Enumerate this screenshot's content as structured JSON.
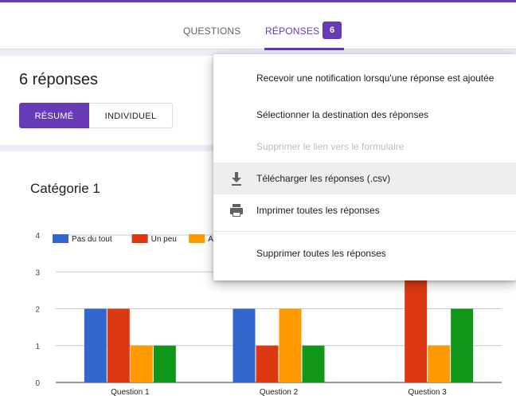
{
  "tabs": {
    "questions_label": "QUESTIONS",
    "responses_label": "RÉPONSES",
    "responses_count": "6"
  },
  "summary": {
    "title": "6 réponses",
    "view_toggle": {
      "summary_label": "RÉSUMÉ",
      "individual_label": "INDIVIDUEL"
    }
  },
  "menu": {
    "items": [
      {
        "label": "Recevoir une notification lorsqu'une réponse est ajoutée",
        "enabled": true
      },
      {
        "label": "Sélectionner la destination des réponses",
        "enabled": true
      },
      {
        "label": "Supprimer le lien vers le formulaire",
        "enabled": false
      },
      {
        "label": "Télécharger les réponses (.csv)",
        "enabled": true,
        "icon": "download-icon",
        "highlighted": true
      },
      {
        "label": "Imprimer toutes les réponses",
        "enabled": true,
        "icon": "print-icon"
      },
      {
        "label": "Supprimer toutes les réponses",
        "enabled": true
      }
    ]
  },
  "colors": {
    "accent": "#673ab7",
    "background": "#f0ebf8",
    "series": [
      "#3366cc",
      "#dc3912",
      "#ff9900",
      "#109618"
    ]
  },
  "chart_data": {
    "type": "bar",
    "title": "Catégorie 1",
    "categories": [
      "Question 1",
      "Question 2",
      "Question 3"
    ],
    "series": [
      {
        "name": "Pas du tout",
        "values": [
          2,
          2,
          0
        ]
      },
      {
        "name": "Un peu",
        "values": [
          2,
          1,
          3
        ]
      },
      {
        "name": "As",
        "values": [
          1,
          2,
          1
        ]
      },
      {
        "name": "",
        "values": [
          1,
          1,
          2
        ]
      }
    ],
    "ylim": [
      0,
      4
    ],
    "yticks": [
      0,
      1,
      2,
      3,
      4
    ],
    "grid": true,
    "legend_position": "top-left"
  }
}
